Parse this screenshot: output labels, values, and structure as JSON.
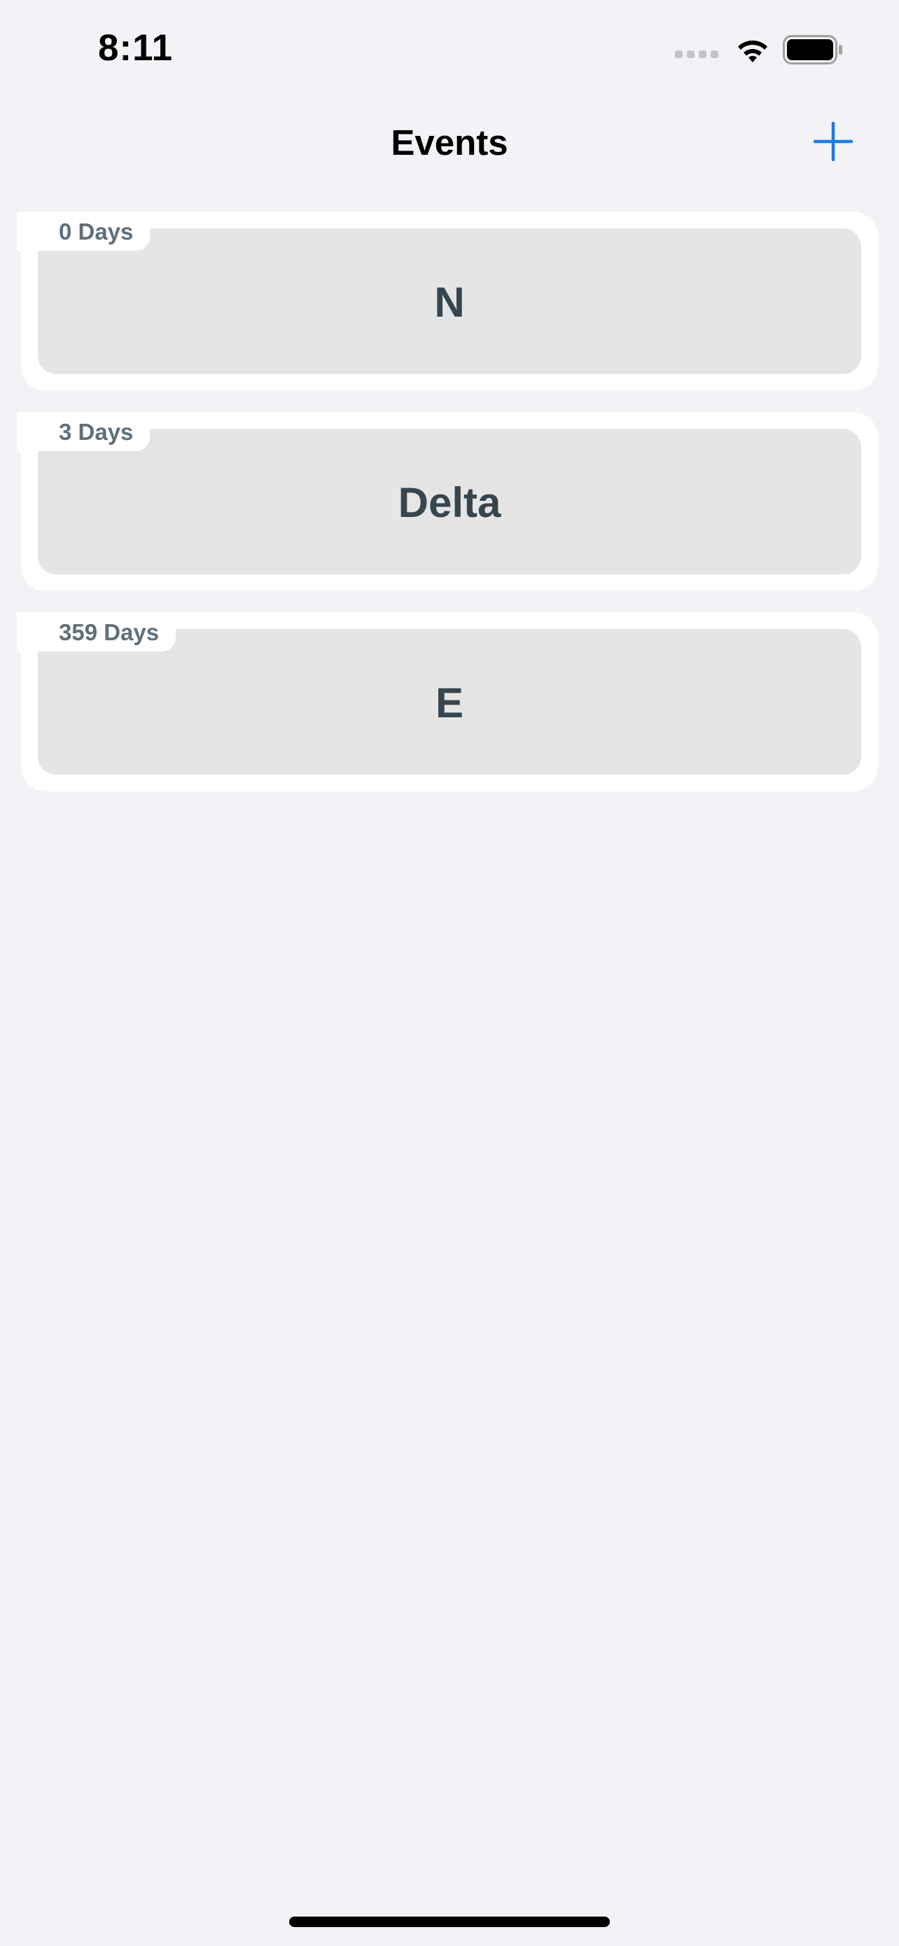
{
  "status_bar": {
    "time": "8:11",
    "icons": [
      "cellular-signal-icon",
      "wifi-icon",
      "battery-icon"
    ]
  },
  "nav": {
    "title": "Events",
    "add_icon": "plus-icon",
    "accent_color": "#1c7ae6"
  },
  "events": [
    {
      "days": "0 Days",
      "title": "N"
    },
    {
      "days": "3 Days",
      "title": "Delta"
    },
    {
      "days": "359 Days",
      "title": "E"
    }
  ],
  "colors": {
    "background": "#f2f2f7",
    "card": "#ffffff",
    "card_inner": "#e5e5e5",
    "title_text": "#37454f",
    "days_text": "#5f6f7a"
  }
}
